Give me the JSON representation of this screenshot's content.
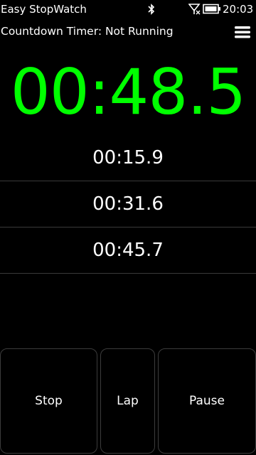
{
  "status_bar": {
    "app_name": "Easy StopWatch",
    "time": "20:03",
    "icons": [
      "bluetooth-icon",
      "signal-icon",
      "battery-icon"
    ]
  },
  "header": {
    "timer_status": "Countdown Timer: Not Running",
    "menu_icon": "hamburger-menu-icon"
  },
  "stopwatch": {
    "elapsed": "00:48.5",
    "color": "#00ff00"
  },
  "laps": [
    {
      "time": "00:15.9"
    },
    {
      "time": "00:31.6"
    },
    {
      "time": "00:45.7"
    }
  ],
  "controls": {
    "stop_label": "Stop",
    "lap_label": "Lap",
    "pause_label": "Pause"
  }
}
